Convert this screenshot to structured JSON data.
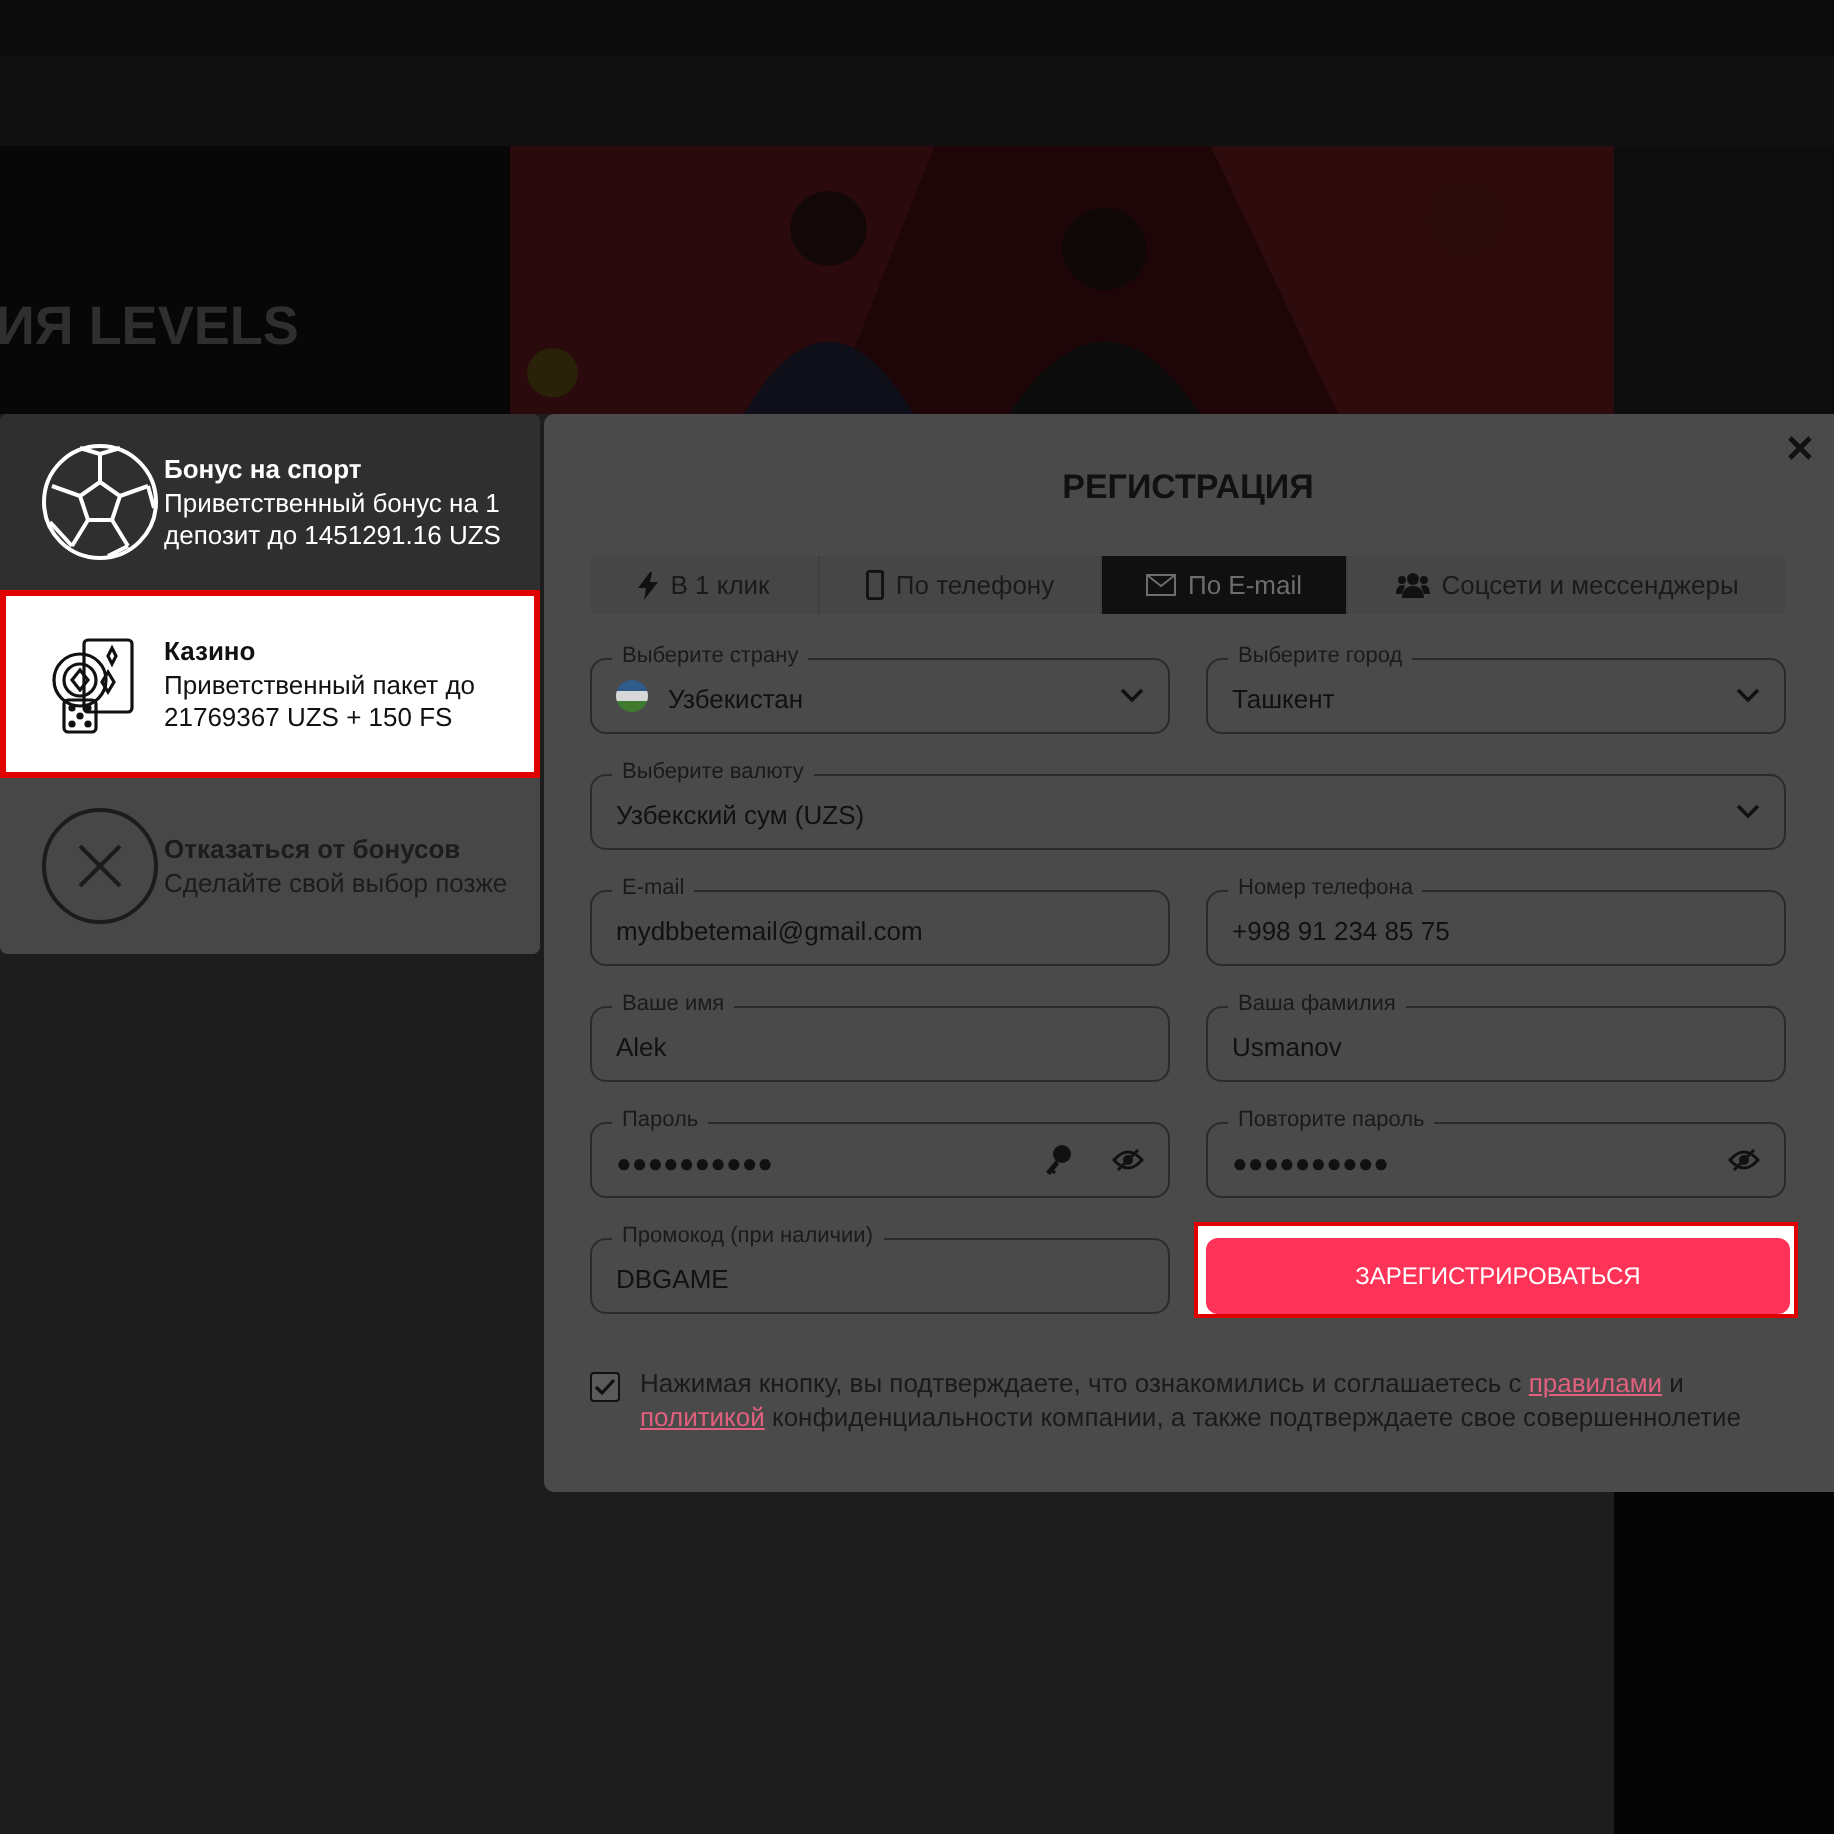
{
  "background": {
    "headline": "ИЯ LEVELS"
  },
  "bonuses": [
    {
      "kind": "sport",
      "title": "Бонус на спорт",
      "text": "Приветственный бонус на 1 депозит до 1451291.16 UZS",
      "selected": false
    },
    {
      "kind": "casino",
      "title": "Казино",
      "text": "Приветственный пакет до 21769367 UZS + 150 FS",
      "selected": true
    },
    {
      "kind": "decline",
      "title": "Отказаться от бонусов",
      "text": "Сделайте свой выбор позже",
      "selected": false
    }
  ],
  "dialog": {
    "title": "РЕГИСТРАЦИЯ",
    "tabs": [
      {
        "kind": "oneclick",
        "label": "В 1 клик",
        "selected": false
      },
      {
        "kind": "phone",
        "label": "По телефону",
        "selected": false
      },
      {
        "kind": "email",
        "label": "По E-mail",
        "selected": true
      },
      {
        "kind": "social",
        "label": "Соцсети и мессенджеры",
        "selected": false
      }
    ],
    "fields": [
      {
        "kind": "country",
        "label": "Выберите страну",
        "value": "Узбекистан",
        "wide": false
      },
      {
        "kind": "select",
        "label": "Выберите город",
        "value": "Ташкент",
        "wide": false
      },
      {
        "kind": "select",
        "label": "Выберите валюту",
        "value": "Узбекский сум (UZS)",
        "wide": true
      },
      {
        "kind": "text",
        "label": "E-mail",
        "value": "mydbbetemail@gmail.com",
        "wide": false
      },
      {
        "kind": "text",
        "label": "Номер телефона",
        "value": "+998 91 234 85 75",
        "wide": false
      },
      {
        "kind": "text",
        "label": "Ваше имя",
        "value": "Alek",
        "wide": false
      },
      {
        "kind": "text",
        "label": "Ваша фамилия",
        "value": "Usmanov",
        "wide": false
      },
      {
        "kind": "newpassword",
        "label": "Пароль",
        "value": "●●●●●●●●●●",
        "wide": false
      },
      {
        "kind": "password",
        "label": "Повторите пароль",
        "value": "●●●●●●●●●●",
        "wide": false
      },
      {
        "kind": "text",
        "label": "Промокод (при наличии)",
        "value": "DBGAME",
        "wide": false
      },
      {
        "kind": "button",
        "label": "ЗАРЕГИСТРИРОВАТЬСЯ",
        "wide": false
      }
    ],
    "consent": {
      "checked": true,
      "parts": [
        {
          "text": "Нажимая кнопку, вы подтверждаете, что ознакомились и соглашаетесь с ",
          "link": false
        },
        {
          "text": "правилами",
          "link": true
        },
        {
          "text": " и ",
          "link": false
        },
        {
          "text": "политикой",
          "link": true
        },
        {
          "text": " конфиденциальности компании, а также подтверждаете свое совершеннолетие",
          "link": false
        }
      ]
    }
  }
}
